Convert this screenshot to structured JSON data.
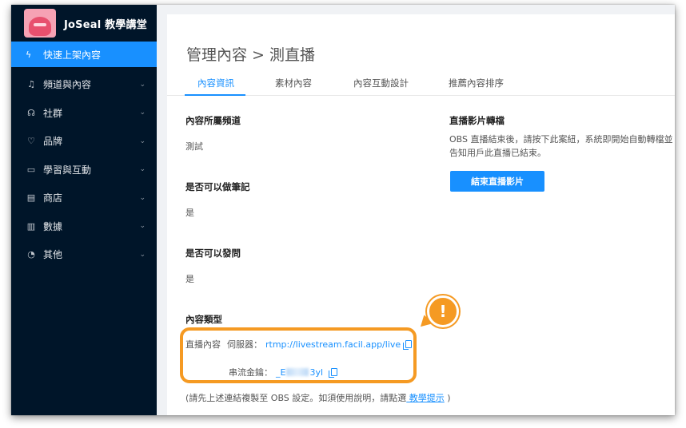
{
  "sidebar": {
    "brand": "JoSeal 教學講堂",
    "quick_action": "快速上架內容",
    "items": [
      {
        "label": "頻道與內容",
        "icon": "bell-icon"
      },
      {
        "label": "社群",
        "icon": "users-icon"
      },
      {
        "label": "品牌",
        "icon": "heart-icon"
      },
      {
        "label": "學習與互動",
        "icon": "book-icon"
      },
      {
        "label": "商店",
        "icon": "store-icon"
      },
      {
        "label": "數據",
        "icon": "bar-chart-icon"
      },
      {
        "label": "其他",
        "icon": "pie-chart-icon"
      }
    ]
  },
  "header": {
    "breadcrumb": "管理內容 > 測直播"
  },
  "tabs": [
    {
      "label": "內容資訊",
      "active": true
    },
    {
      "label": "素材內容",
      "active": false
    },
    {
      "label": "內容互動設計",
      "active": false
    },
    {
      "label": "推薦內容排序",
      "active": false
    }
  ],
  "fields": {
    "channel_label": "內容所屬頻道",
    "channel_value": "測試",
    "notes_label": "是否可以做筆記",
    "notes_value": "是",
    "questions_label": "是否可以發問",
    "questions_value": "是",
    "type_label": "內容類型"
  },
  "stream": {
    "type_value": "直播內容",
    "server_label": "伺服器：",
    "server_url": "rtmp://livestream.facil.app/live",
    "key_label": "串流金鑰：",
    "key_prefix": "_E",
    "key_suffix": "3yl"
  },
  "note": {
    "text": "(請先上述連結複製至 OBS 設定。如須使用說明，請點選",
    "link": " 教學提示",
    "end": " )"
  },
  "transcode": {
    "title": "直播影片轉檔",
    "description": "OBS 直播結束後，請按下此案紐，系統即開始自動轉檔並告知用戶此直播已結束。",
    "button": "結束直播影片"
  },
  "badge": {
    "mark": "!"
  },
  "colors": {
    "accent": "#1890ff",
    "highlight": "#f59a23",
    "sidebar_bg": "#001529"
  }
}
